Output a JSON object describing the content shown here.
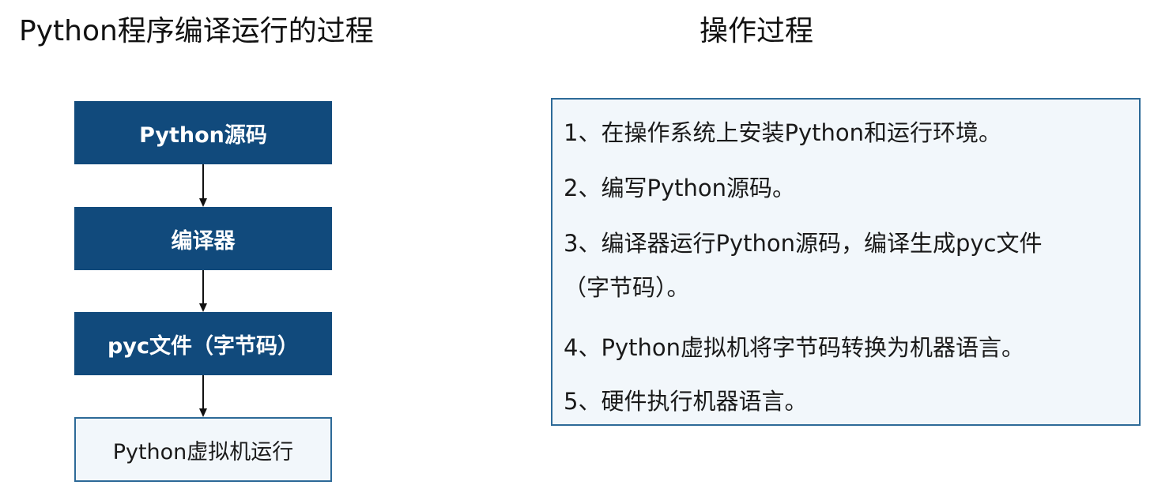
{
  "headings": {
    "left": "Python程序编译运行的过程",
    "right": "操作过程"
  },
  "flow": {
    "source": "Python源码",
    "compiler": "编译器",
    "pyc": "pyc文件（字节码）",
    "vm": "Python虚拟机运行"
  },
  "steps": {
    "s1": "1、在操作系统上安装Python和运行环境。",
    "s2": "2、编写Python源码。",
    "s3_line1": "3、编译器运行Python源码，编译生成pyc文件",
    "s3_line2": "（字节码）。",
    "s4": "4、Python虚拟机将字节码转换为机器语言。",
    "s5": "5、硬件执行机器语言。"
  },
  "colors": {
    "dark_box": "#114a7c",
    "light_fill": "#f2f7fb",
    "border": "#2d6a98",
    "arrow": "#111111"
  }
}
